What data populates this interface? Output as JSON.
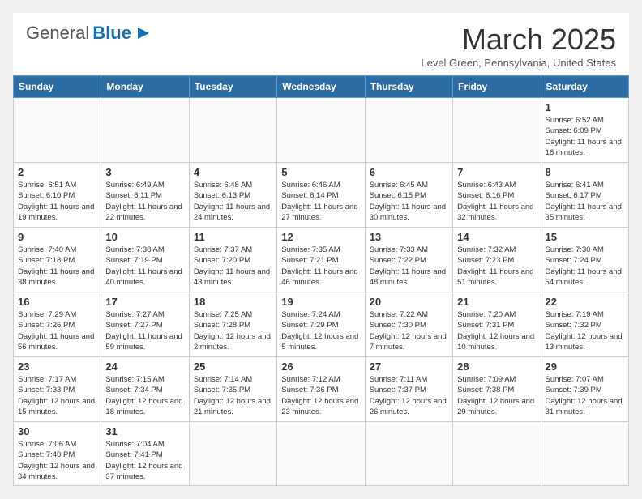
{
  "header": {
    "logo_general": "General",
    "logo_blue": "Blue",
    "month_title": "March 2025",
    "location": "Level Green, Pennsylvania, United States"
  },
  "weekdays": [
    "Sunday",
    "Monday",
    "Tuesday",
    "Wednesday",
    "Thursday",
    "Friday",
    "Saturday"
  ],
  "weeks": [
    [
      {
        "day": "",
        "info": ""
      },
      {
        "day": "",
        "info": ""
      },
      {
        "day": "",
        "info": ""
      },
      {
        "day": "",
        "info": ""
      },
      {
        "day": "",
        "info": ""
      },
      {
        "day": "",
        "info": ""
      },
      {
        "day": "1",
        "info": "Sunrise: 6:52 AM\nSunset: 6:09 PM\nDaylight: 11 hours and 16 minutes."
      }
    ],
    [
      {
        "day": "2",
        "info": "Sunrise: 6:51 AM\nSunset: 6:10 PM\nDaylight: 11 hours and 19 minutes."
      },
      {
        "day": "3",
        "info": "Sunrise: 6:49 AM\nSunset: 6:11 PM\nDaylight: 11 hours and 22 minutes."
      },
      {
        "day": "4",
        "info": "Sunrise: 6:48 AM\nSunset: 6:13 PM\nDaylight: 11 hours and 24 minutes."
      },
      {
        "day": "5",
        "info": "Sunrise: 6:46 AM\nSunset: 6:14 PM\nDaylight: 11 hours and 27 minutes."
      },
      {
        "day": "6",
        "info": "Sunrise: 6:45 AM\nSunset: 6:15 PM\nDaylight: 11 hours and 30 minutes."
      },
      {
        "day": "7",
        "info": "Sunrise: 6:43 AM\nSunset: 6:16 PM\nDaylight: 11 hours and 32 minutes."
      },
      {
        "day": "8",
        "info": "Sunrise: 6:41 AM\nSunset: 6:17 PM\nDaylight: 11 hours and 35 minutes."
      }
    ],
    [
      {
        "day": "9",
        "info": "Sunrise: 7:40 AM\nSunset: 7:18 PM\nDaylight: 11 hours and 38 minutes."
      },
      {
        "day": "10",
        "info": "Sunrise: 7:38 AM\nSunset: 7:19 PM\nDaylight: 11 hours and 40 minutes."
      },
      {
        "day": "11",
        "info": "Sunrise: 7:37 AM\nSunset: 7:20 PM\nDaylight: 11 hours and 43 minutes."
      },
      {
        "day": "12",
        "info": "Sunrise: 7:35 AM\nSunset: 7:21 PM\nDaylight: 11 hours and 46 minutes."
      },
      {
        "day": "13",
        "info": "Sunrise: 7:33 AM\nSunset: 7:22 PM\nDaylight: 11 hours and 48 minutes."
      },
      {
        "day": "14",
        "info": "Sunrise: 7:32 AM\nSunset: 7:23 PM\nDaylight: 11 hours and 51 minutes."
      },
      {
        "day": "15",
        "info": "Sunrise: 7:30 AM\nSunset: 7:24 PM\nDaylight: 11 hours and 54 minutes."
      }
    ],
    [
      {
        "day": "16",
        "info": "Sunrise: 7:29 AM\nSunset: 7:26 PM\nDaylight: 11 hours and 56 minutes."
      },
      {
        "day": "17",
        "info": "Sunrise: 7:27 AM\nSunset: 7:27 PM\nDaylight: 11 hours and 59 minutes."
      },
      {
        "day": "18",
        "info": "Sunrise: 7:25 AM\nSunset: 7:28 PM\nDaylight: 12 hours and 2 minutes."
      },
      {
        "day": "19",
        "info": "Sunrise: 7:24 AM\nSunset: 7:29 PM\nDaylight: 12 hours and 5 minutes."
      },
      {
        "day": "20",
        "info": "Sunrise: 7:22 AM\nSunset: 7:30 PM\nDaylight: 12 hours and 7 minutes."
      },
      {
        "day": "21",
        "info": "Sunrise: 7:20 AM\nSunset: 7:31 PM\nDaylight: 12 hours and 10 minutes."
      },
      {
        "day": "22",
        "info": "Sunrise: 7:19 AM\nSunset: 7:32 PM\nDaylight: 12 hours and 13 minutes."
      }
    ],
    [
      {
        "day": "23",
        "info": "Sunrise: 7:17 AM\nSunset: 7:33 PM\nDaylight: 12 hours and 15 minutes."
      },
      {
        "day": "24",
        "info": "Sunrise: 7:15 AM\nSunset: 7:34 PM\nDaylight: 12 hours and 18 minutes."
      },
      {
        "day": "25",
        "info": "Sunrise: 7:14 AM\nSunset: 7:35 PM\nDaylight: 12 hours and 21 minutes."
      },
      {
        "day": "26",
        "info": "Sunrise: 7:12 AM\nSunset: 7:36 PM\nDaylight: 12 hours and 23 minutes."
      },
      {
        "day": "27",
        "info": "Sunrise: 7:11 AM\nSunset: 7:37 PM\nDaylight: 12 hours and 26 minutes."
      },
      {
        "day": "28",
        "info": "Sunrise: 7:09 AM\nSunset: 7:38 PM\nDaylight: 12 hours and 29 minutes."
      },
      {
        "day": "29",
        "info": "Sunrise: 7:07 AM\nSunset: 7:39 PM\nDaylight: 12 hours and 31 minutes."
      }
    ],
    [
      {
        "day": "30",
        "info": "Sunrise: 7:06 AM\nSunset: 7:40 PM\nDaylight: 12 hours and 34 minutes."
      },
      {
        "day": "31",
        "info": "Sunrise: 7:04 AM\nSunset: 7:41 PM\nDaylight: 12 hours and 37 minutes."
      },
      {
        "day": "",
        "info": ""
      },
      {
        "day": "",
        "info": ""
      },
      {
        "day": "",
        "info": ""
      },
      {
        "day": "",
        "info": ""
      },
      {
        "day": "",
        "info": ""
      }
    ]
  ]
}
